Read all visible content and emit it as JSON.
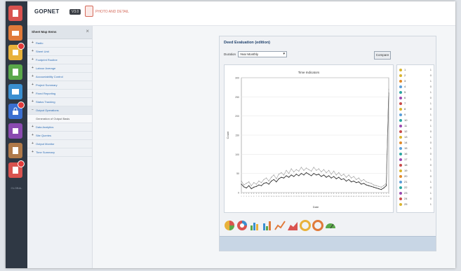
{
  "header": {
    "app_title": "GOPNET",
    "version": "V3.0",
    "action_text": "PHOTO AND DETAIL"
  },
  "launcher": {
    "caption": "GLOBAL"
  },
  "tree": {
    "title": "Sheet Map Items",
    "items": [
      {
        "label": "Radio",
        "kind": "item"
      },
      {
        "label": "Sheet Unit",
        "kind": "item"
      },
      {
        "label": "Footprint Routine",
        "kind": "item"
      },
      {
        "label": "Labour Average",
        "kind": "item"
      },
      {
        "label": "Accountability Control",
        "kind": "item"
      },
      {
        "label": "Project Summary",
        "kind": "item"
      },
      {
        "label": "Fixed Reporting",
        "kind": "item"
      },
      {
        "label": "Status Tracking",
        "kind": "item"
      },
      {
        "label": "Output Operations",
        "kind": "open"
      },
      {
        "label": "Generation of Output Basis",
        "kind": "sub"
      },
      {
        "label": "Data Analytics",
        "kind": "item"
      },
      {
        "label": "Site Queries",
        "kind": "item"
      },
      {
        "label": "Output Monitor",
        "kind": "item"
      },
      {
        "label": "Time Summary",
        "kind": "item"
      }
    ]
  },
  "panel": {
    "title": "Deed Evaluation (edition)",
    "scope_label": "Duration",
    "scope_value": "Year Monthly",
    "run_button": "Compare",
    "chart_caption": "Time Indicators",
    "y_label": "Count",
    "x_label": "Date"
  },
  "colors": {
    "launcher_bg": "#2f3844",
    "accent": "#2d6db5",
    "line_dark": "#333333",
    "line_light": "#9a9a9a"
  },
  "chart_data": {
    "type": "line",
    "ylim": [
      0,
      300
    ],
    "ytick_values": [
      0,
      50,
      100,
      150,
      200,
      250,
      300
    ],
    "grid": true,
    "x": [
      1,
      2,
      3,
      4,
      5,
      6,
      7,
      8,
      9,
      10,
      11,
      12,
      13,
      14,
      15,
      16,
      17,
      18,
      19,
      20,
      21,
      22,
      23,
      24,
      25,
      26,
      27,
      28,
      29,
      30,
      31,
      32,
      33,
      34,
      35,
      36,
      37,
      38,
      39,
      40,
      41,
      42,
      43,
      44,
      45,
      46,
      47,
      48,
      49,
      50,
      51,
      52,
      53,
      54,
      55,
      56,
      57,
      58,
      59,
      60
    ],
    "series": [
      {
        "values": [
          22,
          15,
          12,
          18,
          10,
          14,
          16,
          20,
          18,
          24,
          26,
          22,
          30,
          34,
          28,
          36,
          40,
          38,
          44,
          40,
          46,
          42,
          48,
          44,
          50,
          46,
          52,
          48,
          44,
          50,
          46,
          48,
          42,
          46,
          40,
          44,
          38,
          42,
          36,
          40,
          34,
          36,
          30,
          34,
          28,
          30,
          26,
          28,
          22,
          24,
          20,
          18,
          16,
          14,
          12,
          10,
          8,
          12,
          18,
          260
        ]
      },
      {
        "values": [
          30,
          20,
          24,
          28,
          18,
          26,
          22,
          30,
          26,
          34,
          38,
          30,
          40,
          46,
          36,
          48,
          52,
          46,
          58,
          50,
          62,
          54,
          60,
          56,
          66,
          58,
          64,
          60,
          56,
          66,
          58,
          62,
          54,
          60,
          52,
          58,
          48,
          56,
          46,
          52,
          44,
          48,
          40,
          46,
          38,
          42,
          34,
          38,
          30,
          34,
          28,
          26,
          24,
          20,
          18,
          16,
          14,
          18,
          24,
          270
        ]
      }
    ],
    "legend_rows": [
      {
        "label": "1",
        "value": "1"
      },
      {
        "label": "2",
        "value": "0"
      },
      {
        "label": "3",
        "value": "1"
      },
      {
        "label": "4",
        "value": "0"
      },
      {
        "label": "5",
        "value": "1"
      },
      {
        "label": "6",
        "value": "0"
      },
      {
        "label": "7",
        "value": "1"
      },
      {
        "label": "8",
        "value": "0"
      },
      {
        "label": "9",
        "value": "1"
      },
      {
        "label": "10",
        "value": "0"
      },
      {
        "label": "11",
        "value": "1"
      },
      {
        "label": "12",
        "value": "0"
      },
      {
        "label": "13",
        "value": "1"
      },
      {
        "label": "14",
        "value": "0"
      },
      {
        "label": "15",
        "value": "1"
      },
      {
        "label": "16",
        "value": "0"
      },
      {
        "label": "17",
        "value": "1"
      },
      {
        "label": "18",
        "value": "0"
      },
      {
        "label": "19",
        "value": "1"
      },
      {
        "label": "20",
        "value": "0"
      },
      {
        "label": "21",
        "value": "1"
      },
      {
        "label": "22",
        "value": "0"
      },
      {
        "label": "23",
        "value": "1"
      },
      {
        "label": "24",
        "value": "0"
      },
      {
        "label": "25",
        "value": "1"
      }
    ],
    "legend_colors": [
      "#d8b430",
      "#d8b430",
      "#e08a2a",
      "#5a9ed8",
      "#2aa6a0",
      "#9a4ab0",
      "#c84a4a",
      "#d8b430",
      "#5a9ed8",
      "#2aa6a0",
      "#9a4ab0",
      "#c84a4a",
      "#d8b430",
      "#e08a2a",
      "#5a9ed8",
      "#2aa6a0",
      "#9a4ab0",
      "#c84a4a",
      "#d8b430",
      "#e08a2a",
      "#5a9ed8",
      "#2aa6a0",
      "#9a4ab0",
      "#c84a4a",
      "#d8b430"
    ]
  },
  "chart_type_icons": [
    {
      "name": "pie-chart-icon"
    },
    {
      "name": "donut-chart-icon"
    },
    {
      "name": "bar-chart-icon"
    },
    {
      "name": "column-chart-icon"
    },
    {
      "name": "line-chart-icon"
    },
    {
      "name": "area-chart-icon"
    },
    {
      "name": "ring-chart-icon"
    },
    {
      "name": "radar-chart-icon"
    },
    {
      "name": "gauge-chart-icon"
    }
  ]
}
